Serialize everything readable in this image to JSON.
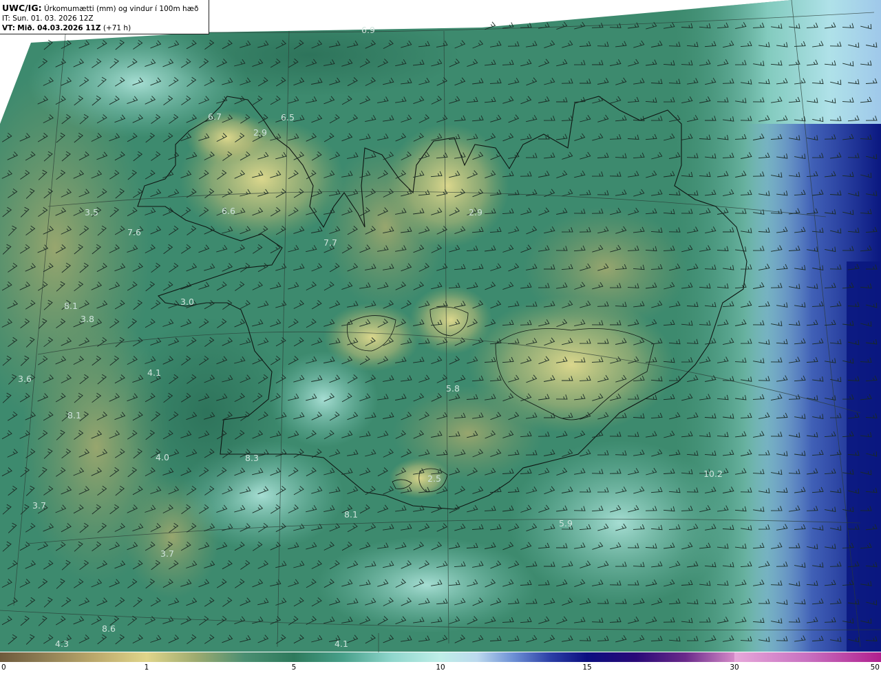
{
  "header": {
    "model": "UWC/IG:",
    "description": "Úrkomumætti (mm) og vindur í 100m hæð",
    "init_time": "IT: Sun. 01. 03. 2026 12Z",
    "valid_prefix": "VT:",
    "valid_time": "Mið. 04.03.2026 11Z",
    "lead": "(+71 h)"
  },
  "legend": {
    "tick_labels": [
      "0",
      "1",
      "5",
      "10",
      "15",
      "30",
      "50"
    ],
    "colors": [
      "#6e5a3c",
      "#bba86b",
      "#e5d98c",
      "#2e7a5c",
      "#48a08a",
      "#b9ece6",
      "#bcd9ee",
      "#2c3fa6",
      "#0c0f80",
      "#4a0a78",
      "#c870c0",
      "#b01f8e"
    ]
  },
  "map_labels": [
    {
      "text": "6.9"
    },
    {
      "text": "6.7"
    },
    {
      "text": "6.5"
    },
    {
      "text": "2.9"
    },
    {
      "text": "6.6"
    },
    {
      "text": "3.5"
    },
    {
      "text": "7.6"
    },
    {
      "text": "7.7"
    },
    {
      "text": "2.9"
    },
    {
      "text": "8.1"
    },
    {
      "text": "3.8"
    },
    {
      "text": "3.0"
    },
    {
      "text": "3.6"
    },
    {
      "text": "4.1"
    },
    {
      "text": "8.1"
    },
    {
      "text": "5.8"
    },
    {
      "text": "4.0"
    },
    {
      "text": "8.3"
    },
    {
      "text": "2.5"
    },
    {
      "text": "3.7"
    },
    {
      "text": "8.1"
    },
    {
      "text": "5.9"
    },
    {
      "text": "10.2"
    },
    {
      "text": "3.7"
    },
    {
      "text": "8.6"
    },
    {
      "text": "4.3"
    },
    {
      "text": "4.1"
    }
  ],
  "colors": {
    "sea_green": "#3f8a70",
    "land_olive": "#9aa66a",
    "high_yellow": "#d6d28a",
    "cyan": "#a9e2da",
    "blue": "#2e4aa8",
    "navy": "#0a1780",
    "barb": "#1a2a24",
    "coast": "#0e1512"
  }
}
